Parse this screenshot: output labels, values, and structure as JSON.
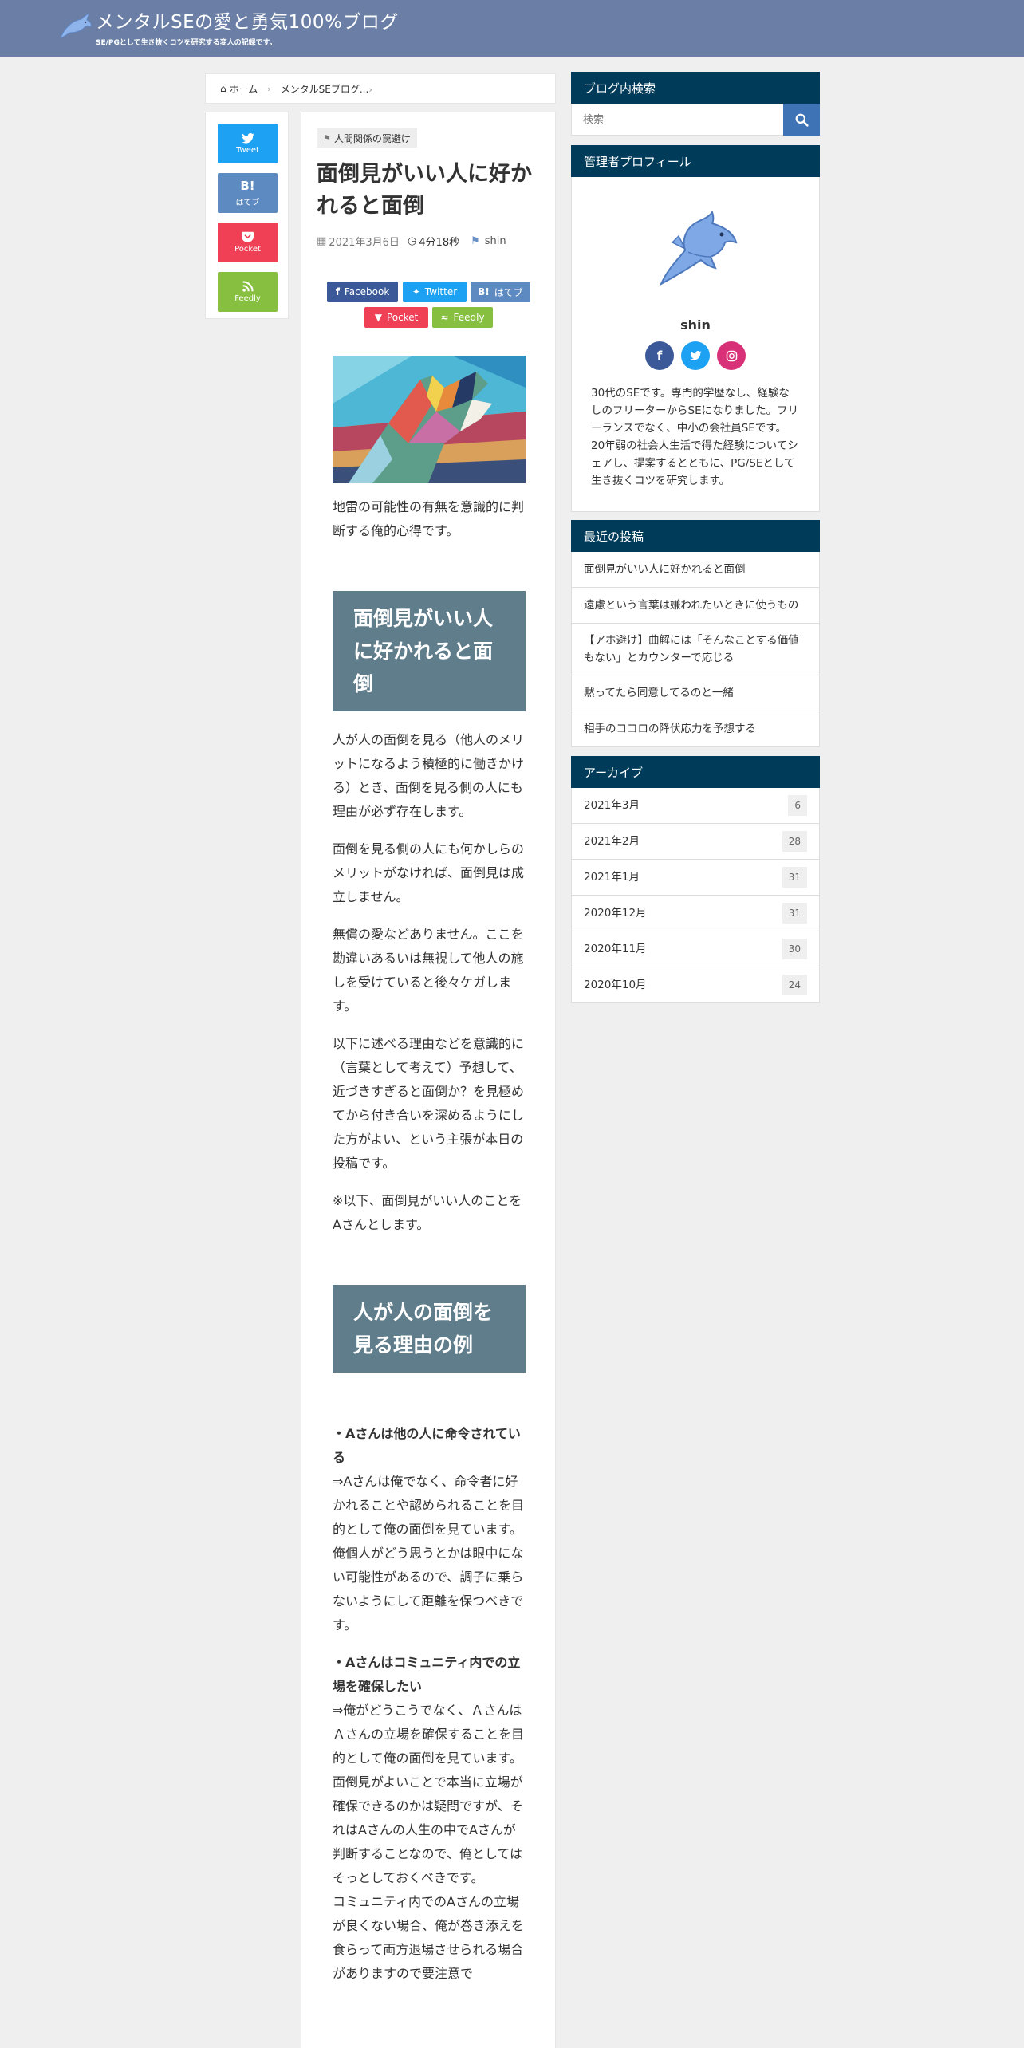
{
  "header": {
    "title": "メンタルSEの愛と勇気100%ブログ",
    "subtitle": "SE/PGとして生き抜くコツを研究する変人の記録です。"
  },
  "breadcrumb": {
    "home": "ホーム",
    "current": "メンタルSEブログ..."
  },
  "share_vertical": [
    {
      "icon": "twitter",
      "label": "Tweet",
      "color": "#1da1f2"
    },
    {
      "icon": "B!",
      "label": "はてブ",
      "color": "#5d8ac1"
    },
    {
      "icon": "pocket",
      "label": "Pocket",
      "color": "#ef4056"
    },
    {
      "icon": "feedly",
      "label": "Feedly",
      "color": "#87c040"
    }
  ],
  "article": {
    "category": "人間関係の罠避け",
    "title": "面倒見がいい人に好かれると面倒",
    "date": "2021年3月6日",
    "read_time": "4分18秒",
    "author": "shin",
    "share": {
      "facebook": "Facebook",
      "twitter": "Twitter",
      "hatebu": "はてブ",
      "pocket": "Pocket",
      "feedly": "Feedly"
    },
    "lead": "地雷の可能性の有無を意識的に判断する俺的心得です。",
    "h2_1": "面倒見がいい人に好かれると面倒",
    "p1": "人が人の面倒を見る（他人のメリットになるよう積極的に働きかける）とき、面倒を見る側の人にも理由が必ず存在します。",
    "p2": "面倒を見る側の人にも何かしらのメリットがなければ、面倒見は成立しません。",
    "p3": "無償の愛などありません。ここを勘違いあるいは無視して他人の施しを受けていると後々ケガします。",
    "p4": "以下に述べる理由などを意識的に（言葉として考えて）予想して、近づきすぎると面倒か？を見極めてから付き合いを深めるようにした方がよい、という主張が本日の投稿です。",
    "p5": "※以下、面倒見がいい人のことをAさんとします。",
    "h2_2": "人が人の面倒を見る理由の例",
    "r1_title": "・Aさんは他の人に命令されている",
    "r1_a": "⇒Aさんは俺でなく、命令者に好かれることや認められることを目的として俺の面倒を見ています。",
    "r1_b": "俺個人がどう思うとかは眼中にない可能性があるので、調子に乗らないようにして距離を保つべきです。",
    "r2_title": "・Aさんはコミュニティ内での立場を確保したい",
    "r2_a": "⇒俺がどうこうでなく、ＡさんはＡさんの立場を確保することを目的として俺の面倒を見ています。",
    "r2_b": "面倒見がよいことで本当に立場が確保できるのかは疑問ですが、それはAさんの人生の中でAさんが判断することなので、俺としてはそっとしておくべきです。",
    "r2_c": "コミュニティ内でのAさんの立場が良くない場合、俺が巻き添えを食らって両方退場させられる場合がありますので要注意で"
  },
  "sidebar": {
    "search_title": "ブログ内検索",
    "search_placeholder": "検索",
    "profile_title": "管理者プロフィール",
    "profile_name": "shin",
    "profile_text": "30代のSEです。専門的学歴なし、経験なしのフリーターからSEになりました。フリーランスでなく、中小の会社員SEです。20年弱の社会人生活で得た経験についてシェアし、提案するとともに、PG/SEとして生き抜くコツを研究します。",
    "recent_title": "最近の投稿",
    "recent_posts": [
      "面倒見がいい人に好かれると面倒",
      "遠慮という言葉は嫌われたいときに使うもの",
      "【アホ避け】曲解には「そんなことする価値もない」とカウンターで応じる",
      "黙ってたら同意してるのと一緒",
      "相手のココロの降伏応力を予想する"
    ],
    "archive_title": "アーカイブ",
    "archives": [
      {
        "label": "2021年3月",
        "count": "6"
      },
      {
        "label": "2021年2月",
        "count": "28"
      },
      {
        "label": "2021年1月",
        "count": "31"
      },
      {
        "label": "2020年12月",
        "count": "31"
      },
      {
        "label": "2020年11月",
        "count": "30"
      },
      {
        "label": "2020年10月",
        "count": "24"
      }
    ]
  },
  "colors": {
    "header_bg": "#6b7fa6",
    "widget_head": "#003c5a",
    "h2_bg": "#607d8b",
    "search_btn": "#3e73b5"
  }
}
